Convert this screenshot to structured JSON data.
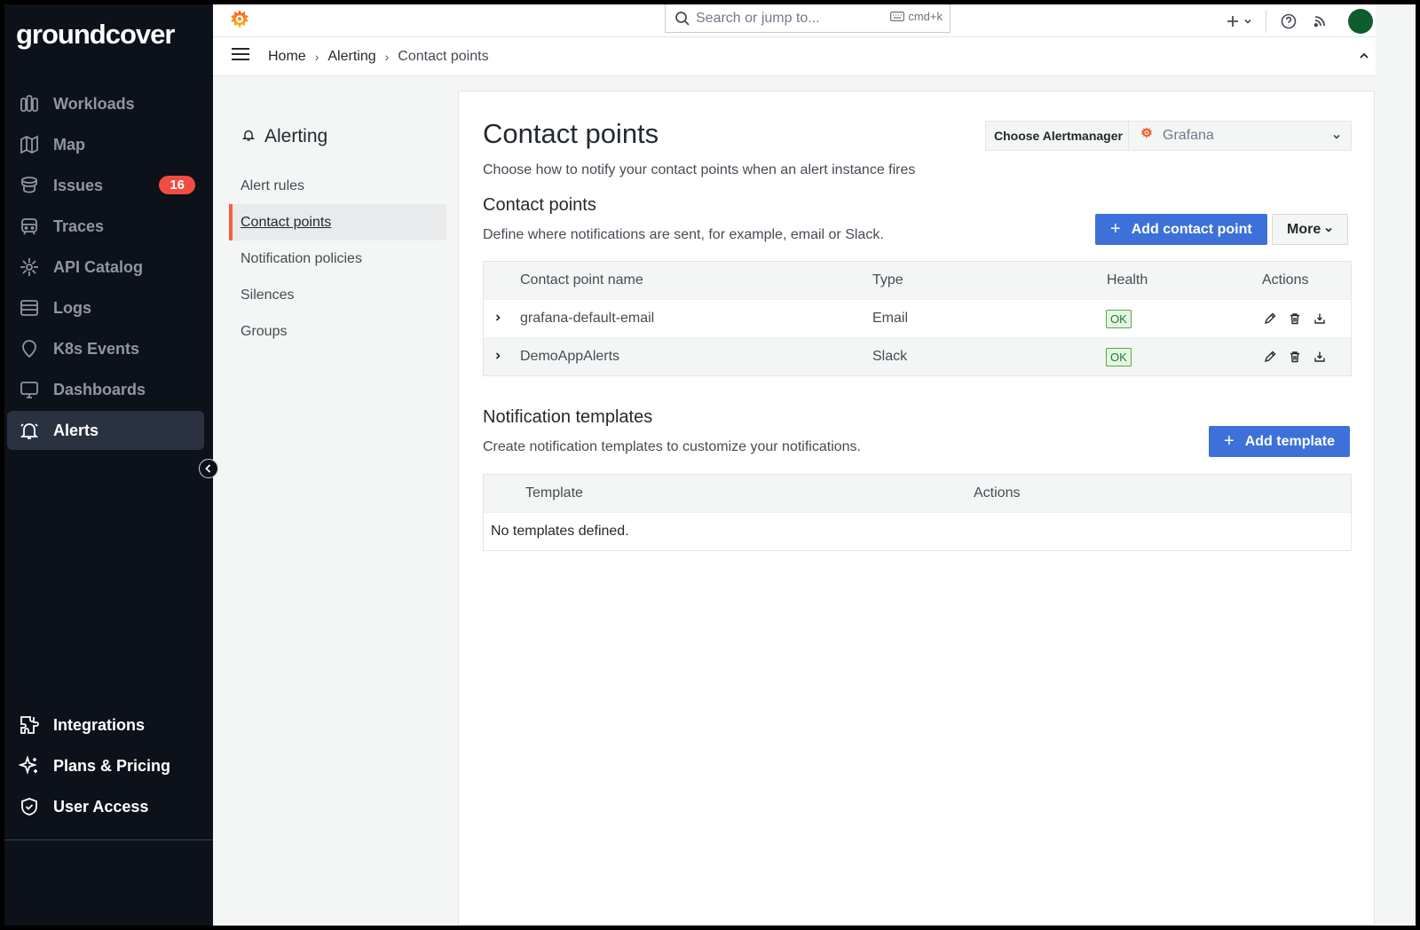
{
  "sidebar": {
    "logo": "groundcover",
    "items": [
      {
        "label": "Workloads",
        "icon": "workloads-icon"
      },
      {
        "label": "Map",
        "icon": "map-icon"
      },
      {
        "label": "Issues",
        "icon": "issues-icon",
        "badge": "16"
      },
      {
        "label": "Traces",
        "icon": "traces-icon"
      },
      {
        "label": "API Catalog",
        "icon": "api-catalog-icon"
      },
      {
        "label": "Logs",
        "icon": "logs-icon"
      },
      {
        "label": "K8s Events",
        "icon": "k8s-events-icon"
      },
      {
        "label": "Dashboards",
        "icon": "dashboards-icon"
      },
      {
        "label": "Alerts",
        "icon": "alerts-icon",
        "active": true
      }
    ],
    "bottom_items": [
      {
        "label": "Integrations",
        "icon": "puzzle-icon"
      },
      {
        "label": "Plans & Pricing",
        "icon": "sparkle-icon"
      },
      {
        "label": "User Access",
        "icon": "shield-icon"
      }
    ]
  },
  "topbar": {
    "search_placeholder": "Search or jump to...",
    "shortcut": "cmd+k"
  },
  "breadcrumb": [
    "Home",
    "Alerting",
    "Contact points"
  ],
  "subnav": {
    "title": "Alerting",
    "items": [
      "Alert rules",
      "Contact points",
      "Notification policies",
      "Silences",
      "Groups"
    ],
    "active_index": 1
  },
  "main": {
    "title": "Contact points",
    "subtitle": "Choose how to notify your contact points when an alert instance fires",
    "alertmanager_label": "Choose Alertmanager",
    "alertmanager_value": "Grafana",
    "contact_section": {
      "title": "Contact points",
      "subtitle": "Define where notifications are sent, for example, email or Slack.",
      "add_button": "Add contact point",
      "more_button": "More",
      "columns": [
        "Contact point name",
        "Type",
        "Health",
        "Actions"
      ],
      "rows": [
        {
          "name": "grafana-default-email",
          "type": "Email",
          "health": "OK"
        },
        {
          "name": "DemoAppAlerts",
          "type": "Slack",
          "health": "OK"
        }
      ]
    },
    "templates_section": {
      "title": "Notification templates",
      "subtitle": "Create notification templates to customize your notifications.",
      "add_button": "Add template",
      "columns": [
        "Template",
        "Actions"
      ],
      "empty_text": "No templates defined."
    }
  },
  "colors": {
    "accent": "#3d71d9",
    "sidebar_bg": "#0d111a",
    "badge": "#f14c43",
    "active_marker": "#f55f3e",
    "ok": "#56a64b"
  }
}
